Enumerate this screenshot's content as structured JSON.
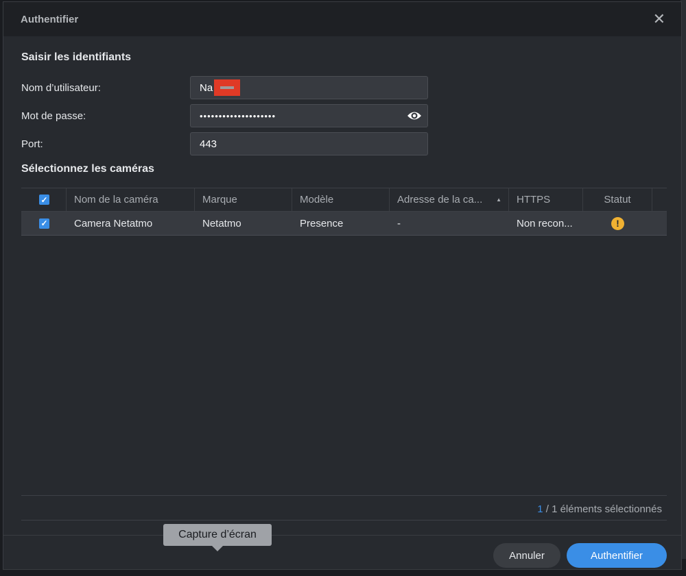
{
  "dialog": {
    "title": "Authentifier"
  },
  "credentials": {
    "heading": "Saisir les identifiants",
    "username_label": "Nom d’utilisateur:",
    "username_value": "Na",
    "password_label": "Mot de passe:",
    "password_value": "••••••••••••••••••••",
    "port_label": "Port:",
    "port_value": "443"
  },
  "cameras": {
    "heading": "Sélectionnez les caméras",
    "columns": [
      "Nom de la caméra",
      "Marque",
      "Modèle",
      "Adresse de la ca...",
      "HTTPS",
      "Statut"
    ],
    "rows": [
      {
        "name": "Camera Netatmo",
        "brand": "Netatmo",
        "model": "Presence",
        "address": "-",
        "https": "Non recon...",
        "status": "warning"
      }
    ]
  },
  "footer": {
    "selected": "1",
    "total_text": " / 1 éléments sélectionnés"
  },
  "buttons": {
    "cancel": "Annuler",
    "ok": "Authentifier"
  },
  "tooltip": "Capture d’écran",
  "colors": {
    "accent": "#3a8ee6",
    "warning": "#f0b132"
  }
}
